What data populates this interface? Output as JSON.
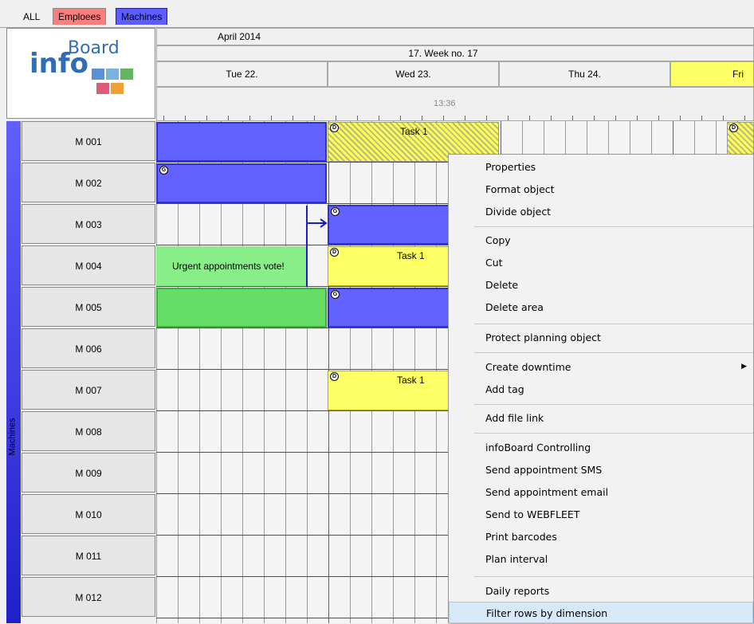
{
  "tabs": {
    "all": "ALL",
    "employees": "Emploees",
    "machines": "Machines"
  },
  "logo": {
    "info": "info",
    "board": "Board"
  },
  "header": {
    "month": "April 2014",
    "week": "17. Week no. 17",
    "days": [
      "Tue 22.",
      "Wed 23.",
      "Thu 24.",
      "Fri"
    ],
    "time": "13:36"
  },
  "group_label": "Machines",
  "rows": [
    "M 001",
    "M 002",
    "M 003",
    "M 004",
    "M 005",
    "M 006",
    "M 007",
    "M 008",
    "M 009",
    "M 010",
    "M 011",
    "M 012"
  ],
  "tasks": {
    "task1": "Task 1",
    "urgent": "Urgent appointments vote!",
    "badge_g": "G",
    "badge_d": "D"
  },
  "menu": {
    "properties": "Properties",
    "format_object": "Format object",
    "divide_object": "Divide object",
    "copy": "Copy",
    "cut": "Cut",
    "delete": "Delete",
    "delete_area": "Delete area",
    "protect": "Protect planning object",
    "create_downtime": "Create downtime",
    "add_tag": "Add tag",
    "add_file_link": "Add file link",
    "controlling": "infoBoard Controlling",
    "send_sms": "Send appointment SMS",
    "send_email": "Send appointment email",
    "send_webfleet": "Send to WEBFLEET",
    "print_barcodes": "Print barcodes",
    "plan_interval": "Plan interval",
    "daily_reports": "Daily reports",
    "filter_rows": "Filter rows by dimension"
  },
  "colors": {
    "plan_blue": "#6262ff",
    "plan_green": "#66dd66",
    "plan_yellow": "#ffff66"
  }
}
